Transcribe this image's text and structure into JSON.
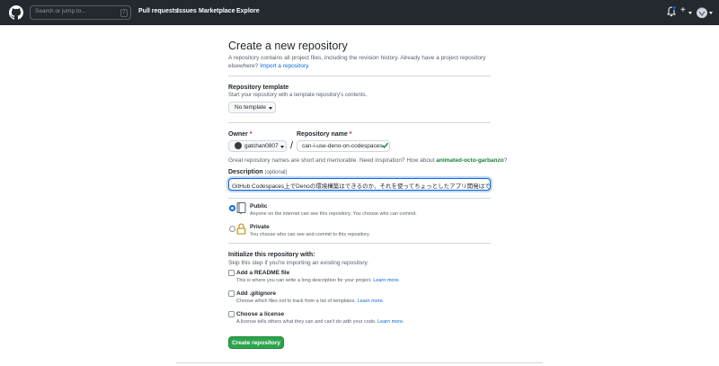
{
  "header": {
    "search_placeholder": "Search or jump to...",
    "search_shortcut": "/",
    "nav": [
      "Pull requests",
      "Issues",
      "Marketplace",
      "Explore"
    ],
    "plus_label": "+"
  },
  "page": {
    "title": "Create a new repository",
    "subtitle": "A repository contains all project files, including the revision history. Already have a project repository elsewhere?",
    "import_link": "Import a repository."
  },
  "template": {
    "label": "Repository template",
    "help": "Start your repository with a template repository's contents.",
    "button": "No template"
  },
  "owner": {
    "label": "Owner",
    "required": "*",
    "value": "gatchan0807"
  },
  "repo_name": {
    "label": "Repository name",
    "required": "*",
    "value": "can-i-use-deno-on-codespaces"
  },
  "name_hint": {
    "text": "Great repository names are short and memorable. Need inspiration? How about",
    "suggestion": "animated-octo-garbanzo",
    "end": "?"
  },
  "description": {
    "label": "Description",
    "optional": "(optional)",
    "value": "GitHub Codespaces上でDenoの環境構築はできるのか、それを使ってちょっとしたアプリ開発はできるのか"
  },
  "visibility": {
    "public_title": "Public",
    "public_desc": "Anyone on the internet can see this repository. You choose who can commit.",
    "private_title": "Private",
    "private_desc": "You choose who can see and commit to this repository.",
    "selected": "Public"
  },
  "init": {
    "label": "Initialize this repository with:",
    "help": "Skip this step if you're importing an existing repository.",
    "readme_title": "Add a README file",
    "readme_desc": "This is where you can write a long description for your project.",
    "gitignore_title": "Add .gitignore",
    "gitignore_desc": "Choose which files not to track from a list of templates.",
    "license_title": "Choose a license",
    "license_desc": "A license tells others what they can and can't do with your code.",
    "learn_more": "Learn more."
  },
  "submit": {
    "label": "Create repository"
  },
  "colors": {
    "header_bg": "#24292f",
    "accent": "#0969da",
    "success": "#2da44e",
    "danger": "#cf222e"
  }
}
